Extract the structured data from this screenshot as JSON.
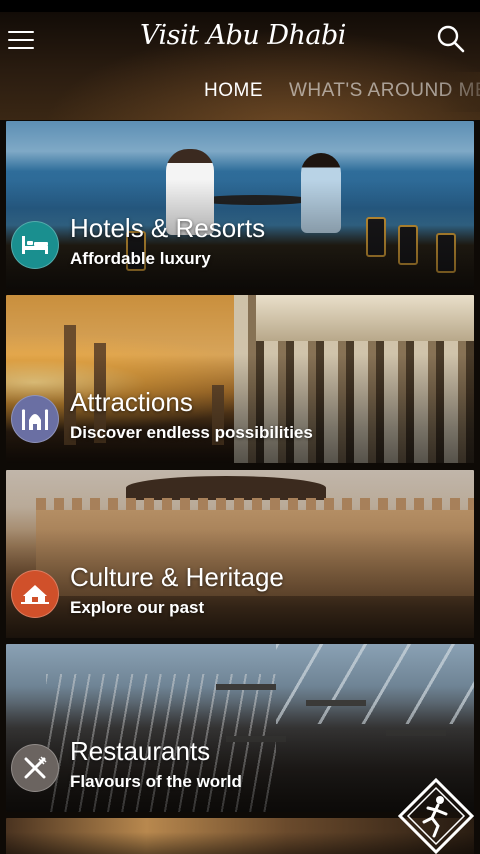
{
  "app": {
    "logo_text": "Visit Abu Dhabi"
  },
  "header": {
    "menu_icon": "hamburger-menu-icon",
    "search_icon": "search-icon"
  },
  "tabs": [
    {
      "label": "HOME",
      "active": true
    },
    {
      "label": "WHAT'S AROUND ME",
      "active": false
    }
  ],
  "categories": [
    {
      "title": "Hotels & Resorts",
      "subtitle": "Affordable luxury",
      "icon": "bed-icon",
      "icon_color": "#1a8f8f"
    },
    {
      "title": "Attractions",
      "subtitle": "Discover endless possibilities",
      "icon": "mosque-icon",
      "icon_color": "#6a6fa3"
    },
    {
      "title": "Culture & Heritage",
      "subtitle": "Explore our past",
      "icon": "heritage-tent-icon",
      "icon_color": "#d0502a"
    },
    {
      "title": "Restaurants",
      "subtitle": "Flavours of the world",
      "icon": "fork-knife-icon",
      "icon_color": "#6b6460"
    }
  ],
  "floating_badge": {
    "icon": "runner-badge-icon"
  },
  "colors": {
    "background": "#0e0a06",
    "tab_active": "#ffffff",
    "tab_inactive": "#a69684"
  }
}
